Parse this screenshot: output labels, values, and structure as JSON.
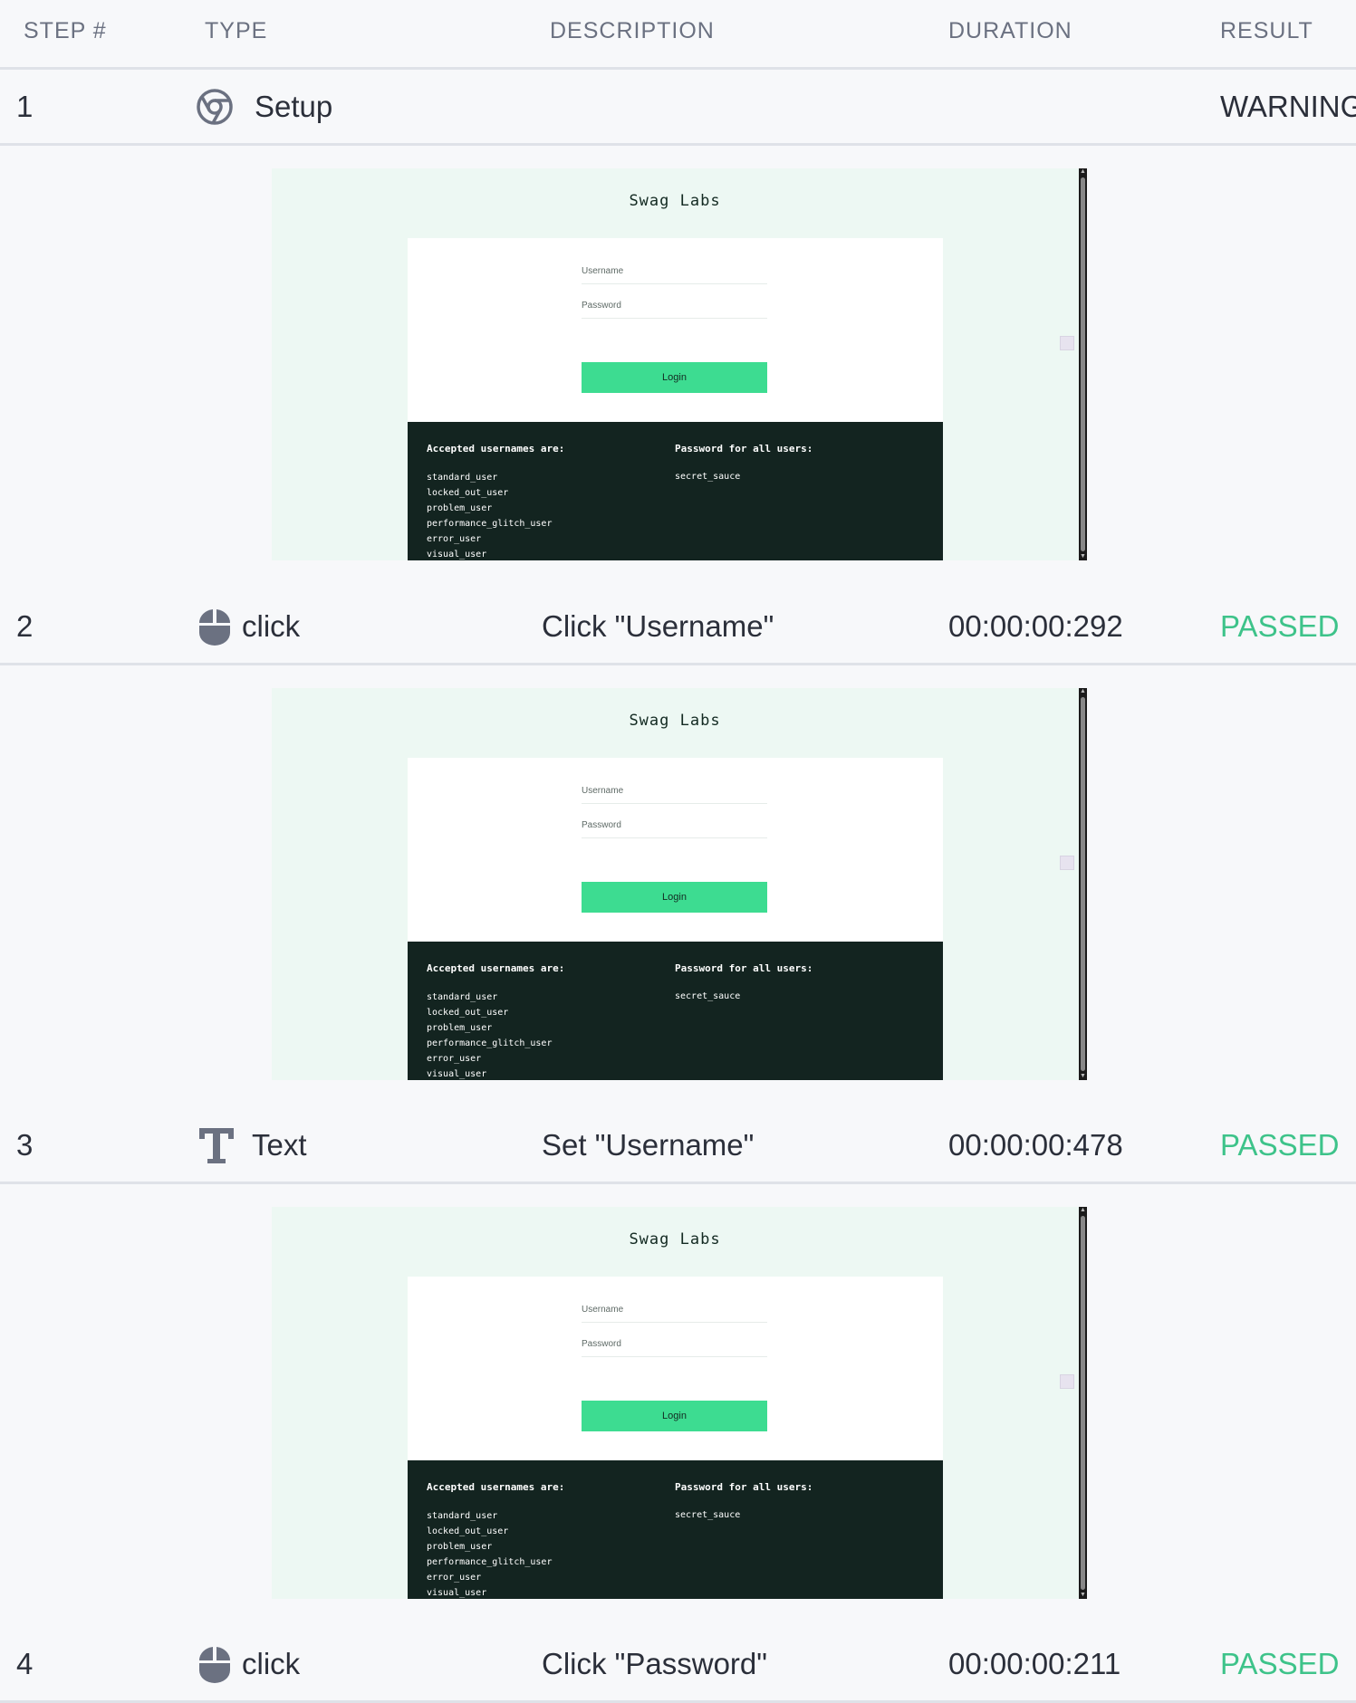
{
  "columns": [
    "STEP #",
    "TYPE",
    "DESCRIPTION",
    "DURATION",
    "RESULT"
  ],
  "steps": [
    {
      "number": "1",
      "type": "Setup",
      "icon": "chrome-icon",
      "description": "",
      "duration": "",
      "result": "WARNING"
    },
    {
      "number": "2",
      "type": "click",
      "icon": "mouse-icon",
      "description": "Click \"Username\"",
      "duration": "00:00:00:292",
      "result": "PASSED"
    },
    {
      "number": "3",
      "type": "Text",
      "icon": "text-icon",
      "description": "Set \"Username\"",
      "duration": "00:00:00:478",
      "result": "PASSED"
    },
    {
      "number": "4",
      "type": "click",
      "icon": "mouse-icon",
      "description": "Click \"Password\"",
      "duration": "00:00:00:211",
      "result": "PASSED"
    }
  ],
  "screenshot": {
    "brand": "Swag Labs",
    "username_placeholder": "Username",
    "password_placeholder": "Password",
    "login_label": "Login",
    "accepted_heading": "Accepted usernames are:",
    "usernames": [
      "standard_user",
      "locked_out_user",
      "problem_user",
      "performance_glitch_user",
      "error_user",
      "visual_user"
    ],
    "password_heading": "Password for all users:",
    "password_value": "secret_sauce"
  },
  "colors": {
    "passed": "#3ec38a",
    "warning": "#2b2f3a",
    "accent": "#3ddc91"
  }
}
